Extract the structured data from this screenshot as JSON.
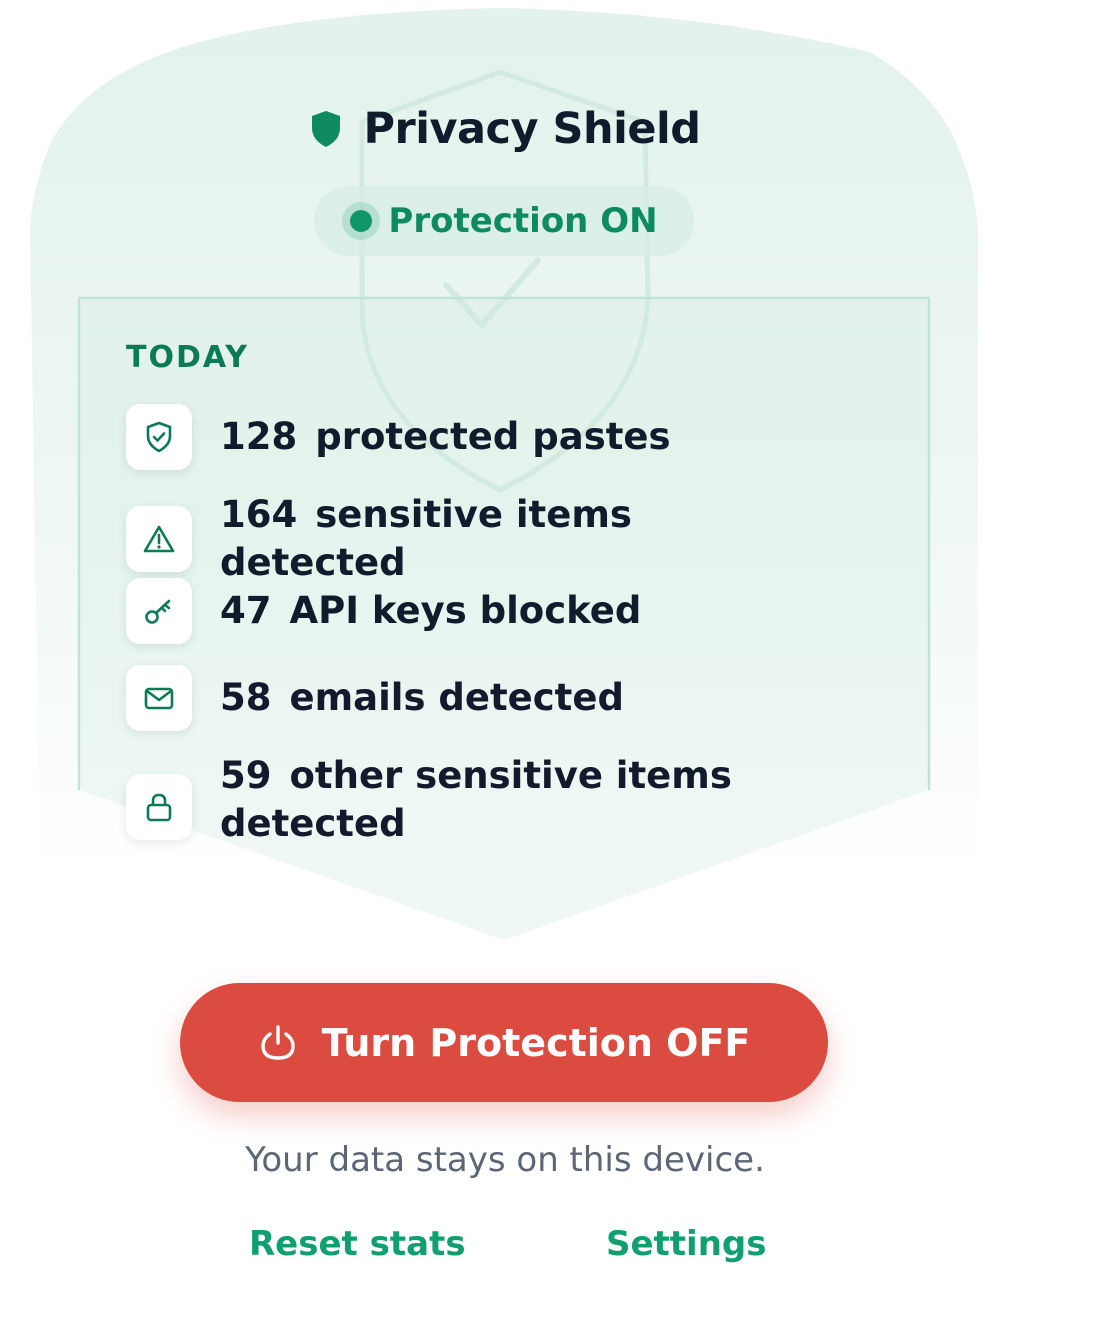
{
  "header": {
    "title": "Privacy Shield",
    "title_icon": "shield-icon",
    "status": "Protection ON",
    "status_color": "#11966b"
  },
  "stats": {
    "section_label": "TODAY",
    "items": [
      {
        "count": "128",
        "label": "protected pastes",
        "icon": "shield-check-icon"
      },
      {
        "count": "164",
        "label": "sensitive items detected",
        "icon": "warning-icon"
      },
      {
        "count": "47",
        "label": "API keys blocked",
        "icon": "key-icon"
      },
      {
        "count": "58",
        "label": "emails detected",
        "icon": "mail-icon"
      },
      {
        "count": "59",
        "label": "other sensitive items detected",
        "icon": "lock-icon"
      }
    ]
  },
  "action": {
    "label": "Turn Protection OFF",
    "icon": "power-icon",
    "color": "#dc4b3f"
  },
  "footer": {
    "note": "Your data stays on this device.",
    "reset_label": "Reset stats",
    "settings_label": "Settings"
  },
  "theme": {
    "accent": "#10a070",
    "text": "#111b2b"
  }
}
